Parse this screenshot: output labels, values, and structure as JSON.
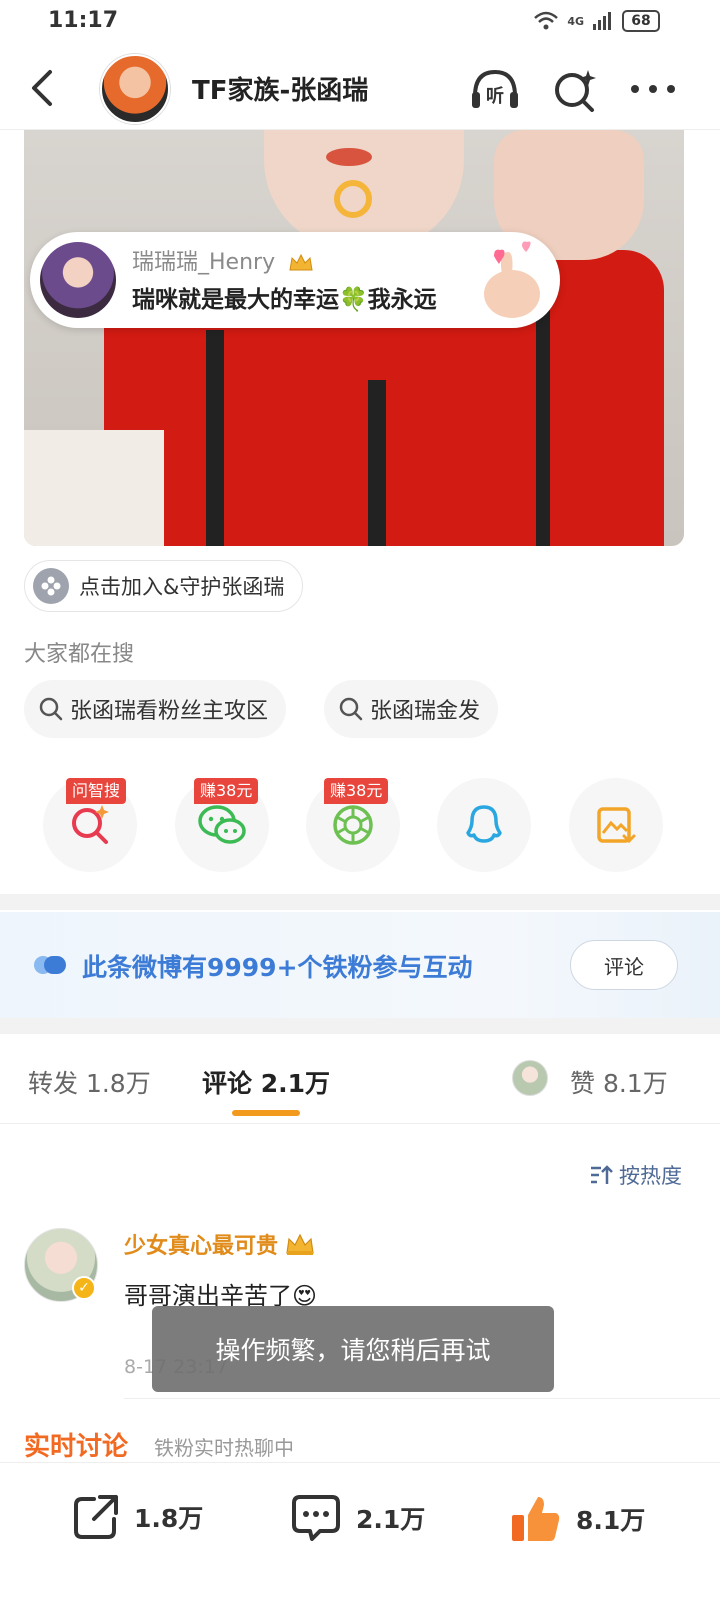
{
  "status_bar": {
    "time": "11:17",
    "network": "4G",
    "battery": "68"
  },
  "header": {
    "title": "TF家族-张函瑞"
  },
  "bubble": {
    "username": "瑞瑞瑞_Henry",
    "message": "瑞咪就是最大的幸运🍀我永远"
  },
  "join": {
    "label": "点击加入&守护张函瑞"
  },
  "search": {
    "title": "大家都在搜",
    "chips": [
      "张函瑞看粉丝主攻区",
      "张函瑞金发"
    ]
  },
  "share": {
    "badges": [
      "问智搜",
      "赚38元",
      "赚38元"
    ],
    "icons": [
      "smart-search-icon",
      "wechat-icon",
      "moments-icon",
      "qq-icon",
      "save-image-icon"
    ]
  },
  "fan_banner": {
    "text": "此条微博有9999+个铁粉参与互动",
    "button": "评论"
  },
  "tabs": {
    "repost": "转发 1.8万",
    "comments": "评论 2.1万",
    "likes": "赞 8.1万"
  },
  "sort_label": "按热度",
  "comment": {
    "username": "少女真心最可贵",
    "text": "哥哥演出辛苦了😍",
    "time": "8-17 23:17"
  },
  "toast": "操作频繁，请您稍后再试",
  "realtime": {
    "title": "实时讨论",
    "subtitle": "铁粉实时热聊中"
  },
  "bottom_bar": {
    "repost": "1.8万",
    "comment": "2.1万",
    "like": "8.1万"
  },
  "colors": {
    "accent": "#f29a1e",
    "like": "#f26a22",
    "fan_text": "#3d7cd6",
    "badge": "#e8453c"
  }
}
